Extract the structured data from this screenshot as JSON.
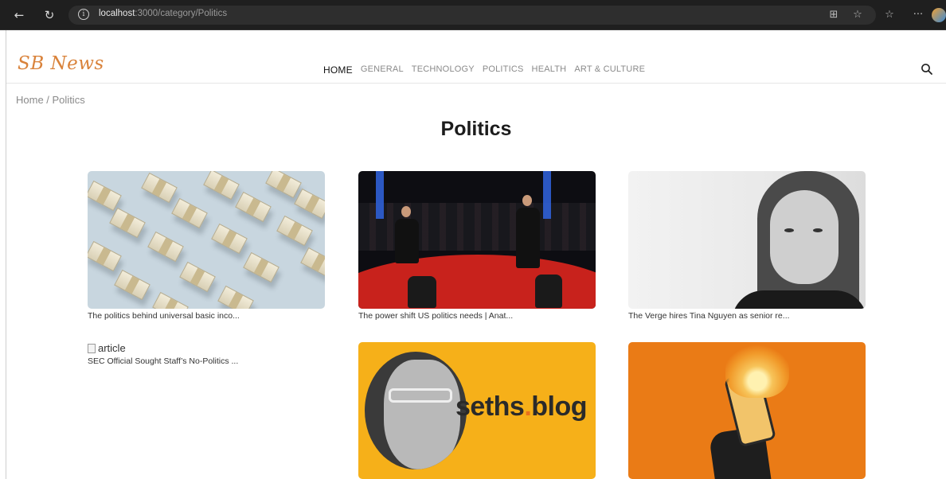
{
  "browser": {
    "url_host": "localhost",
    "url_path": ":3000/category/Politics"
  },
  "site": {
    "logo": "SB News",
    "nav": [
      "HOME",
      "GENERAL",
      "TECHNOLOGY",
      "POLITICS",
      "HEALTH",
      "ART & CULTURE"
    ],
    "nav_active": "HOME"
  },
  "breadcrumb": "Home / Politics",
  "page_title": "Politics",
  "articles": [
    {
      "caption": "The politics behind universal basic inco..."
    },
    {
      "caption": "The power shift US politics needs | Anat..."
    },
    {
      "caption": "The Verge hires Tina Nguyen as senior re..."
    },
    {
      "caption": "SEC Official Sought Staff’s No-Politics ...",
      "broken_image_alt": "article"
    },
    {
      "caption": "",
      "image_text_a": "seths",
      "image_text_dot": ".",
      "image_text_b": "blog"
    },
    {
      "caption": ""
    }
  ]
}
